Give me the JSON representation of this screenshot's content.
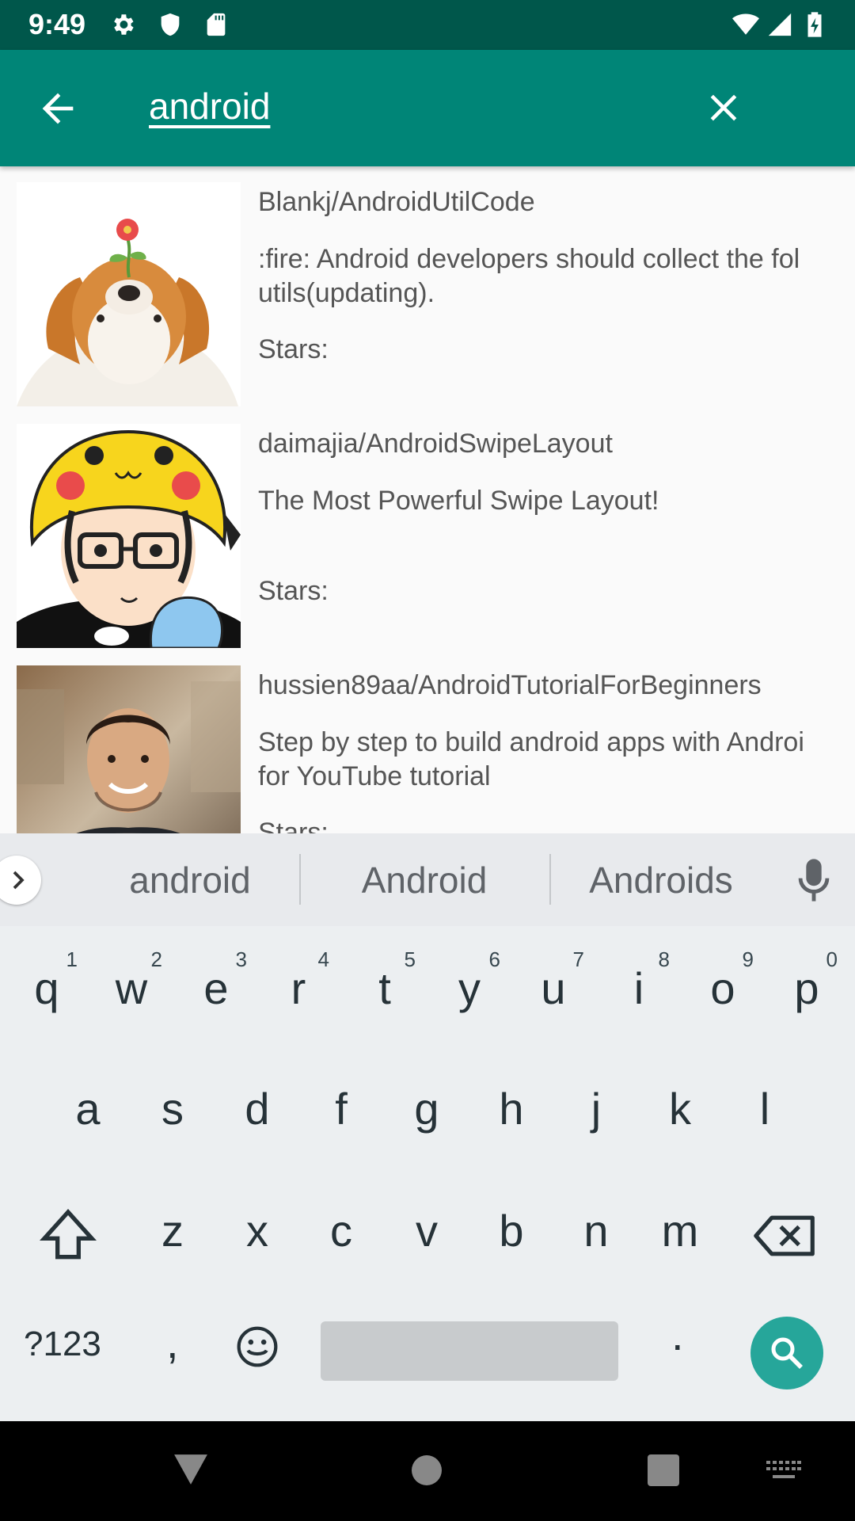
{
  "status_bar": {
    "time": "9:49",
    "icons": [
      "gear-icon",
      "shield-icon",
      "sd-card-icon",
      "wifi-icon",
      "signal-icon",
      "battery-charging-icon"
    ]
  },
  "app_bar": {
    "search_query": "android",
    "colors": {
      "primary": "#008577",
      "primary_dark": "#00574b"
    }
  },
  "results": [
    {
      "name": "Blankj/AndroidUtilCode",
      "description": ":fire: Android developers should collect the fol\nutils(updating).",
      "stars_label": "Stars:",
      "avatar": "corgi-with-flower-avatar"
    },
    {
      "name": "daimajia/AndroidSwipeLayout",
      "description": "The Most Powerful Swipe Layout!",
      "stars_label": "Stars:",
      "avatar": "cartoon-pikachu-hat-avatar"
    },
    {
      "name": "hussien89aa/AndroidTutorialForBeginners",
      "description": "Step by step to build android apps with Androi\nfor YouTube tutorial",
      "stars_label": "Stars:",
      "avatar": "smiling-man-photo-avatar"
    }
  ],
  "keyboard": {
    "suggestions": [
      "android",
      "Android",
      "Androids"
    ],
    "row1": [
      {
        "letter": "q",
        "num": "1"
      },
      {
        "letter": "w",
        "num": "2"
      },
      {
        "letter": "e",
        "num": "3"
      },
      {
        "letter": "r",
        "num": "4"
      },
      {
        "letter": "t",
        "num": "5"
      },
      {
        "letter": "y",
        "num": "6"
      },
      {
        "letter": "u",
        "num": "7"
      },
      {
        "letter": "i",
        "num": "8"
      },
      {
        "letter": "o",
        "num": "9"
      },
      {
        "letter": "p",
        "num": "0"
      }
    ],
    "row2": [
      "a",
      "s",
      "d",
      "f",
      "g",
      "h",
      "j",
      "k",
      "l"
    ],
    "row3": [
      "z",
      "x",
      "c",
      "v",
      "b",
      "n",
      "m"
    ],
    "symbols_label": "?123",
    "comma": ",",
    "period": ".",
    "action_color": "#26a69a"
  },
  "nav_bar": {
    "icons": [
      "back-triangle-icon",
      "home-circle-icon",
      "recents-square-icon",
      "keyboard-switch-icon"
    ]
  }
}
